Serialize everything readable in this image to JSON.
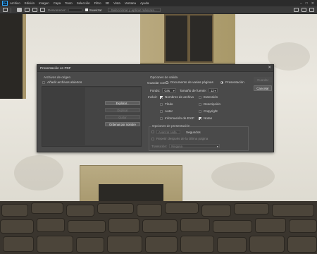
{
  "menubar": {
    "logo": "Ps",
    "items": [
      "Archivo",
      "Edición",
      "Imagen",
      "Capa",
      "Texto",
      "Selección",
      "Filtro",
      "3D",
      "Vista",
      "Ventana",
      "Ayuda"
    ],
    "window_controls": [
      "–",
      "□",
      "✕"
    ]
  },
  "options_bar": {
    "feather_label": "Desvanecer:",
    "smooth_label": "Suavizar",
    "select_mask_label": "Seleccionar y aplicar máscara..."
  },
  "dialog": {
    "title": "Presentación en PDF",
    "close_glyph": "✕",
    "source": {
      "section_label": "Archivos de origen",
      "add_open_files_label": "Añadir archivos abiertos",
      "add_open_files_checked": false,
      "buttons": {
        "browse": "Explorar...",
        "duplicate": "Duplicar",
        "remove": "Quitar",
        "sort": "Ordenar por nombre"
      }
    },
    "output": {
      "section_label": "Opciones de salida",
      "save_as_label": "Guardar como:",
      "radio_multipage": "Documento de varias páginas",
      "radio_presentation": "Presentación",
      "presentation_selected": true,
      "background_label": "Fondo:",
      "background_value": "Gris",
      "font_size_label": "Tamaño de fuente:",
      "font_size_value": "12",
      "include_label": "Incluir:",
      "include_options": [
        {
          "label": "Nombres de archivo",
          "checked": true
        },
        {
          "label": "Extensión",
          "checked": false
        },
        {
          "label": "Título",
          "checked": false
        },
        {
          "label": "Descripción",
          "checked": false
        },
        {
          "label": "Autor",
          "checked": false
        },
        {
          "label": "Copyright",
          "checked": false
        },
        {
          "label": "Información de EXIF",
          "checked": false
        },
        {
          "label": "Notas",
          "checked": true
        }
      ]
    },
    "presentation": {
      "section_label": "Opciones de presentación",
      "advance_label": "Avanzar cada",
      "seconds_label": "Segundos",
      "loop_label": "Repetir después de la última página",
      "transition_label": "Transición:",
      "transition_value": "Ninguna"
    },
    "actions": {
      "save_label": "Guardar",
      "cancel_label": "Cancelar"
    }
  }
}
